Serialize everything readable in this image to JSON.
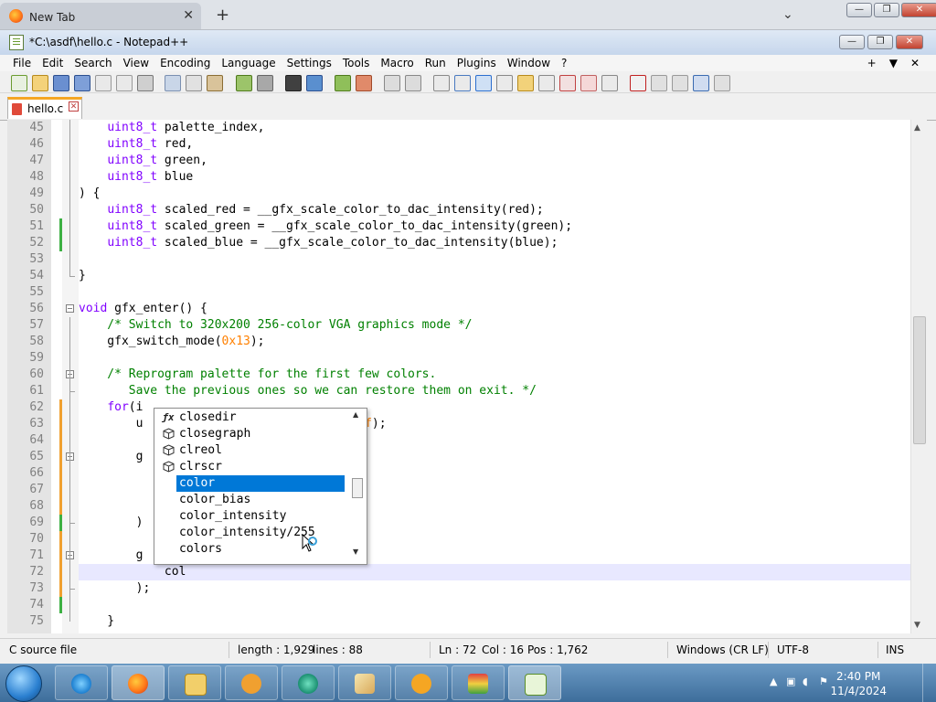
{
  "browser": {
    "tab_title": "New Tab",
    "tab_close": "✕",
    "new_tab": "+",
    "tab_list": "⌄",
    "win_buttons": [
      "—",
      "❐",
      "✕"
    ]
  },
  "npp": {
    "title": "*C:\\asdf\\hello.c - Notepad++",
    "win_buttons": [
      "—",
      "❐",
      "✕"
    ]
  },
  "menu": {
    "items": [
      "File",
      "Edit",
      "Search",
      "View",
      "Encoding",
      "Language",
      "Settings",
      "Tools",
      "Macro",
      "Run",
      "Plugins",
      "Window",
      "?"
    ],
    "right": [
      "+",
      "▼",
      "✕"
    ]
  },
  "doc_tab": {
    "label": "hello.c",
    "close": "✕"
  },
  "code_lines": [
    {
      "n": "45",
      "code": "    uint8_t palette_index,"
    },
    {
      "n": "46",
      "code": "    uint8_t red,"
    },
    {
      "n": "47",
      "code": "    uint8_t green,"
    },
    {
      "n": "48",
      "code": "    uint8_t blue"
    },
    {
      "n": "49",
      "code": ") {"
    },
    {
      "n": "50",
      "code": "    uint8_t scaled_red = __gfx_scale_color_to_dac_intensity(red);"
    },
    {
      "n": "51",
      "code": "    uint8_t scaled_green = __gfx_scale_color_to_dac_intensity(green);"
    },
    {
      "n": "52",
      "code": "    uint8_t scaled_blue = __gfx_scale_color_to_dac_intensity(blue);"
    },
    {
      "n": "53",
      "code": ""
    },
    {
      "n": "54",
      "code": "}"
    },
    {
      "n": "55",
      "code": ""
    },
    {
      "n": "56",
      "code": "void gfx_enter() {"
    },
    {
      "n": "57",
      "code": "    /* Switch to 320x200 256-color VGA graphics mode */"
    },
    {
      "n": "58",
      "code": "    gfx_switch_mode(0x13);"
    },
    {
      "n": "59",
      "code": ""
    },
    {
      "n": "60",
      "code": "    /* Reprogram palette for the first few colors."
    },
    {
      "n": "61",
      "code": "       Save the previous ones so we can restore them on exit. */"
    },
    {
      "n": "62",
      "code": "    for(i"
    },
    {
      "n": "63",
      "code": "        u                          / 0x1f);"
    },
    {
      "n": "64",
      "code": ""
    },
    {
      "n": "65",
      "code": "        g"
    },
    {
      "n": "66",
      "code": ""
    },
    {
      "n": "67",
      "code": ""
    },
    {
      "n": "68",
      "code": ""
    },
    {
      "n": "69",
      "code": "        )"
    },
    {
      "n": "70",
      "code": ""
    },
    {
      "n": "71",
      "code": "        g"
    },
    {
      "n": "72",
      "code": "            col"
    },
    {
      "n": "73",
      "code": "        );"
    },
    {
      "n": "74",
      "code": ""
    },
    {
      "n": "75",
      "code": "    }"
    }
  ],
  "autocomplete": {
    "items": [
      {
        "icon": "fx",
        "text": "closedir"
      },
      {
        "icon": "box",
        "text": "closegraph"
      },
      {
        "icon": "box",
        "text": "clreol"
      },
      {
        "icon": "box",
        "text": "clrscr"
      },
      {
        "icon": "",
        "text": "color"
      },
      {
        "icon": "",
        "text": "color_bias"
      },
      {
        "icon": "",
        "text": "color_intensity"
      },
      {
        "icon": "",
        "text": "color_intensity/255"
      },
      {
        "icon": "",
        "text": "colors"
      }
    ],
    "selected_index": 4
  },
  "status": {
    "file_type": "C source file",
    "length": "length : 1,929",
    "lines": "lines : 88",
    "ln": "Ln : 72",
    "col": "Col : 16",
    "pos": "Pos : 1,762",
    "eol": "Windows (CR LF)",
    "encoding": "UTF-8",
    "mode": "INS"
  },
  "taskbar": {
    "time": "2:40 PM",
    "date": "11/4/2024"
  },
  "colors": {
    "keyword": "#8000ff",
    "comment": "#008000",
    "number": "#ff8000",
    "selection": "#0078d7"
  }
}
